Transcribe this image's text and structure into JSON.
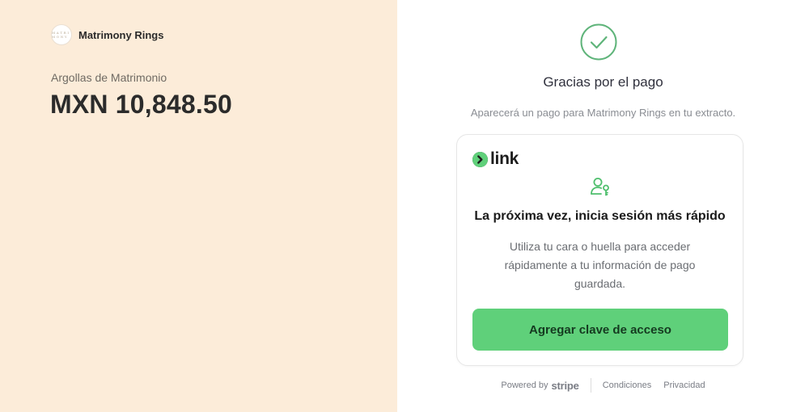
{
  "merchant": {
    "name": "Matrimony Rings",
    "logo_text": "M A T R I M O N Y"
  },
  "order": {
    "product": "Argollas de Matrimonio",
    "amount": "MXN 10,848.50"
  },
  "confirmation": {
    "title": "Gracias por el pago",
    "statement_note": "Aparecerá un pago para Matrimony Rings en tu extracto."
  },
  "link_card": {
    "brand": "link",
    "heading": "La próxima vez, inicia sesión más rápido",
    "body": "Utiliza tu cara o huella para acceder rápidamente a tu información de pago guardada.",
    "button_label": "Agregar clave de acceso"
  },
  "footer": {
    "powered_by": "Powered by",
    "stripe": "stripe",
    "terms": "Condiciones",
    "privacy": "Privacidad"
  },
  "colors": {
    "left_background": "#fcecd9",
    "success_green": "#5fb47a",
    "link_green": "#5fd07a"
  },
  "icons": [
    "check-circle-icon",
    "link-arrow-icon",
    "user-key-icon"
  ]
}
